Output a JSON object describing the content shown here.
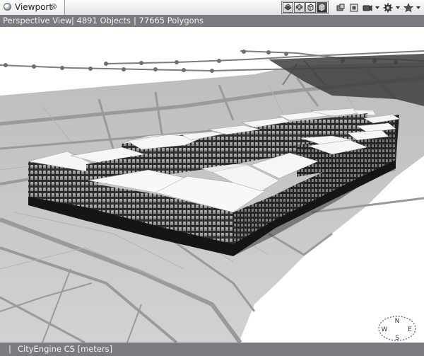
{
  "tab": {
    "label": "Viewport",
    "close_glyph": "⊗",
    "icon": "globe-icon"
  },
  "toolbar": {
    "view_modes": [
      "shaded-view-icon",
      "wireframe-view-icon",
      "textured-view-icon",
      "shaded-textured-view-icon"
    ],
    "tools": [
      "camera-bookmark-icon",
      "frame-icon",
      "camera-icon",
      "settings-gear-icon",
      "bookmark-star-icon"
    ]
  },
  "info": {
    "view_name": "Perspective View",
    "objects": "| 4891 Objects",
    "polygons": "| 77665 Polygons"
  },
  "status": {
    "separator": "|",
    "coordinate_system": "CityEngine CS [meters]"
  },
  "compass": {
    "letters": {
      "north": "N",
      "south": "S",
      "east": "E",
      "west": "W"
    }
  },
  "colors": {
    "info_bar": "#7a7b80",
    "ground": "#c9c9c9",
    "road": "#a4a4a4",
    "building_roof": "#f7f7f7",
    "building_facade": "#3a3a3a"
  }
}
